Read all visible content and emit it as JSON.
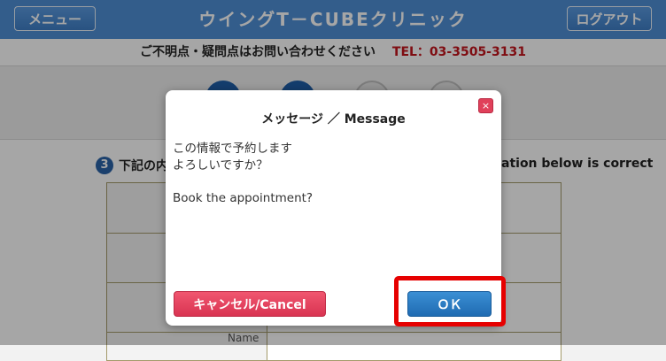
{
  "header": {
    "menu_label": "メニュー",
    "title": "ウイングT－CUBEクリニック",
    "logout_label": "ログアウト"
  },
  "contact": {
    "message": "ご不明点・疑問点はお問い合わせください",
    "tel": "TEL：03-3505-3131"
  },
  "steps": {
    "completed": 2,
    "total": 4
  },
  "content": {
    "step_number": "3",
    "step_text_jp": "下記の内",
    "step_text_en": "ation below is correct",
    "table_label_partial": "Name"
  },
  "modal": {
    "title": "メッセージ ／ Message",
    "close_symbol": "×",
    "message_jp_1": "この情報で予約します",
    "message_jp_2": "よろしいですか？",
    "message_en": "Book the appointment?",
    "cancel_label": "キャンセル/Cancel",
    "ok_label": "ＯＫ"
  },
  "colors": {
    "header_bg": "#4f8fd6",
    "tel_color": "#c4141d",
    "cancel_bg": "#e0405a",
    "ok_bg": "#2a7cc4",
    "highlight": "#e60000"
  }
}
